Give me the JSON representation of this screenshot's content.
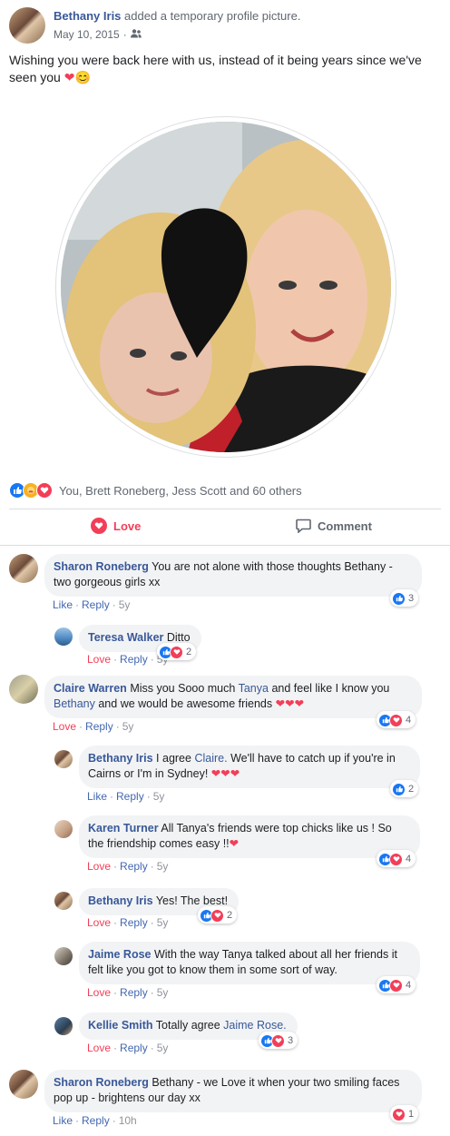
{
  "post": {
    "author": "Bethany Iris",
    "action_text": "added a temporary profile picture.",
    "date": "May 10, 2015",
    "text": "Wishing you were back here with us, instead of it being years since we've seen you",
    "text_emoji": "❤😊"
  },
  "reactions_summary": "You, Brett Roneberg, Jess Scott and 60 others",
  "buttons": {
    "love": "Love",
    "comment": "Comment"
  },
  "comments": [
    {
      "name": "Sharon Roneberg",
      "text": "You are not alone with those thoughts Bethany - two gorgeous girls xx",
      "a1": "Like",
      "a2": "Reply",
      "time": "5y",
      "count": "3"
    },
    {
      "name": "Teresa Walker",
      "text": "Ditto",
      "a1": "Love",
      "a2": "Reply",
      "time": "5y",
      "count": "2"
    },
    {
      "name": "Claire Warren",
      "text_a": "Miss you Sooo much",
      "tag1": "Tanya",
      "text_b": "and feel like I know you",
      "tag2": "Bethany",
      "text_c": "and we would be awesome friends",
      "hearts": "❤❤❤",
      "a1": "Love",
      "a2": "Reply",
      "time": "5y",
      "count": "4"
    },
    {
      "name": "Bethany Iris",
      "text_a": "I agree",
      "tag1": "Claire.",
      "text_b": "We'll have to catch up if you're in Cairns or I'm in Sydney!",
      "hearts": "❤❤❤",
      "a1": "Like",
      "a2": "Reply",
      "time": "5y",
      "count": "2"
    },
    {
      "name": "Karen Turner",
      "text": "All Tanya's friends were top chicks like us ! So the friendship comes easy !!",
      "hearts": "❤",
      "a1": "Love",
      "a2": "Reply",
      "time": "5y",
      "count": "4"
    },
    {
      "name": "Bethany Iris",
      "text": "Yes! The best!",
      "a1": "Love",
      "a2": "Reply",
      "time": "5y",
      "count": "2"
    },
    {
      "name": "Jaime Rose",
      "text": "With the way Tanya talked about all her friends it felt like you got to know them in some sort of way.",
      "a1": "Love",
      "a2": "Reply",
      "time": "5y",
      "count": "4"
    },
    {
      "name": "Kellie Smith",
      "text_a": "Totally agree",
      "tag1": "Jaime Rose.",
      "a1": "Love",
      "a2": "Reply",
      "time": "5y",
      "count": "3"
    },
    {
      "name": "Sharon Roneberg",
      "text": "Bethany - we Love it when your two smiling faces pop up - brightens our day xx",
      "a1": "Like",
      "a2": "Reply",
      "time": "10h",
      "count": "1"
    }
  ],
  "icons": [
    "friends-icon",
    "like-icon",
    "love-icon",
    "care-icon",
    "comment-icon"
  ],
  "colors": {
    "link": "#385898",
    "love": "#f33e58",
    "like": "#1877f2",
    "bubble": "#f2f3f5"
  }
}
